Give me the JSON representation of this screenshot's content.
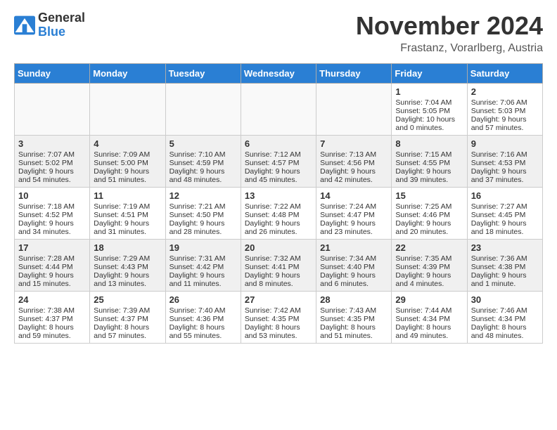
{
  "header": {
    "logo_line1": "General",
    "logo_line2": "Blue",
    "month_title": "November 2024",
    "location": "Frastanz, Vorarlberg, Austria"
  },
  "days_of_week": [
    "Sunday",
    "Monday",
    "Tuesday",
    "Wednesday",
    "Thursday",
    "Friday",
    "Saturday"
  ],
  "weeks": [
    [
      {
        "day": "",
        "empty": true
      },
      {
        "day": "",
        "empty": true
      },
      {
        "day": "",
        "empty": true
      },
      {
        "day": "",
        "empty": true
      },
      {
        "day": "",
        "empty": true
      },
      {
        "day": "1",
        "sunrise": "7:04 AM",
        "sunset": "5:05 PM",
        "daylight": "10 hours and 0 minutes."
      },
      {
        "day": "2",
        "sunrise": "7:06 AM",
        "sunset": "5:03 PM",
        "daylight": "9 hours and 57 minutes."
      }
    ],
    [
      {
        "day": "3",
        "sunrise": "7:07 AM",
        "sunset": "5:02 PM",
        "daylight": "9 hours and 54 minutes."
      },
      {
        "day": "4",
        "sunrise": "7:09 AM",
        "sunset": "5:00 PM",
        "daylight": "9 hours and 51 minutes."
      },
      {
        "day": "5",
        "sunrise": "7:10 AM",
        "sunset": "4:59 PM",
        "daylight": "9 hours and 48 minutes."
      },
      {
        "day": "6",
        "sunrise": "7:12 AM",
        "sunset": "4:57 PM",
        "daylight": "9 hours and 45 minutes."
      },
      {
        "day": "7",
        "sunrise": "7:13 AM",
        "sunset": "4:56 PM",
        "daylight": "9 hours and 42 minutes."
      },
      {
        "day": "8",
        "sunrise": "7:15 AM",
        "sunset": "4:55 PM",
        "daylight": "9 hours and 39 minutes."
      },
      {
        "day": "9",
        "sunrise": "7:16 AM",
        "sunset": "4:53 PM",
        "daylight": "9 hours and 37 minutes."
      }
    ],
    [
      {
        "day": "10",
        "sunrise": "7:18 AM",
        "sunset": "4:52 PM",
        "daylight": "9 hours and 34 minutes."
      },
      {
        "day": "11",
        "sunrise": "7:19 AM",
        "sunset": "4:51 PM",
        "daylight": "9 hours and 31 minutes."
      },
      {
        "day": "12",
        "sunrise": "7:21 AM",
        "sunset": "4:50 PM",
        "daylight": "9 hours and 28 minutes."
      },
      {
        "day": "13",
        "sunrise": "7:22 AM",
        "sunset": "4:48 PM",
        "daylight": "9 hours and 26 minutes."
      },
      {
        "day": "14",
        "sunrise": "7:24 AM",
        "sunset": "4:47 PM",
        "daylight": "9 hours and 23 minutes."
      },
      {
        "day": "15",
        "sunrise": "7:25 AM",
        "sunset": "4:46 PM",
        "daylight": "9 hours and 20 minutes."
      },
      {
        "day": "16",
        "sunrise": "7:27 AM",
        "sunset": "4:45 PM",
        "daylight": "9 hours and 18 minutes."
      }
    ],
    [
      {
        "day": "17",
        "sunrise": "7:28 AM",
        "sunset": "4:44 PM",
        "daylight": "9 hours and 15 minutes."
      },
      {
        "day": "18",
        "sunrise": "7:29 AM",
        "sunset": "4:43 PM",
        "daylight": "9 hours and 13 minutes."
      },
      {
        "day": "19",
        "sunrise": "7:31 AM",
        "sunset": "4:42 PM",
        "daylight": "9 hours and 11 minutes."
      },
      {
        "day": "20",
        "sunrise": "7:32 AM",
        "sunset": "4:41 PM",
        "daylight": "9 hours and 8 minutes."
      },
      {
        "day": "21",
        "sunrise": "7:34 AM",
        "sunset": "4:40 PM",
        "daylight": "9 hours and 6 minutes."
      },
      {
        "day": "22",
        "sunrise": "7:35 AM",
        "sunset": "4:39 PM",
        "daylight": "9 hours and 4 minutes."
      },
      {
        "day": "23",
        "sunrise": "7:36 AM",
        "sunset": "4:38 PM",
        "daylight": "9 hours and 1 minute."
      }
    ],
    [
      {
        "day": "24",
        "sunrise": "7:38 AM",
        "sunset": "4:37 PM",
        "daylight": "8 hours and 59 minutes."
      },
      {
        "day": "25",
        "sunrise": "7:39 AM",
        "sunset": "4:37 PM",
        "daylight": "8 hours and 57 minutes."
      },
      {
        "day": "26",
        "sunrise": "7:40 AM",
        "sunset": "4:36 PM",
        "daylight": "8 hours and 55 minutes."
      },
      {
        "day": "27",
        "sunrise": "7:42 AM",
        "sunset": "4:35 PM",
        "daylight": "8 hours and 53 minutes."
      },
      {
        "day": "28",
        "sunrise": "7:43 AM",
        "sunset": "4:35 PM",
        "daylight": "8 hours and 51 minutes."
      },
      {
        "day": "29",
        "sunrise": "7:44 AM",
        "sunset": "4:34 PM",
        "daylight": "8 hours and 49 minutes."
      },
      {
        "day": "30",
        "sunrise": "7:46 AM",
        "sunset": "4:34 PM",
        "daylight": "8 hours and 48 minutes."
      }
    ]
  ]
}
